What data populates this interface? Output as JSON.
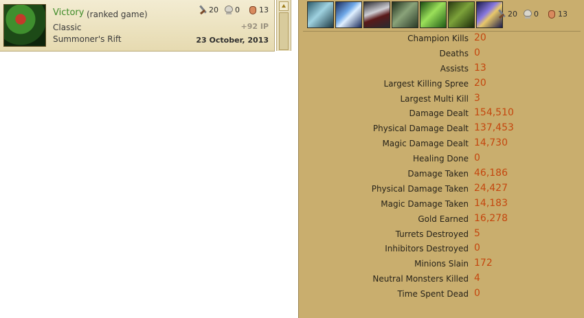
{
  "game": {
    "result": "Victory",
    "mode": "(ranked game)",
    "queue": "Classic",
    "map": "Summoner's Rift",
    "ip": "+92 IP",
    "date": "23 October, 2013",
    "champion_icon": "champion-portrait"
  },
  "kda": {
    "kills": "20",
    "deaths": "0",
    "assists": "13"
  },
  "icons": {
    "kills": "sword-icon",
    "deaths": "skull-icon",
    "assists": "hand-icon"
  },
  "items": [
    "item-1",
    "item-2",
    "item-3",
    "item-4",
    "item-5",
    "item-6",
    "item-7"
  ],
  "stats": [
    {
      "label": "Champion Kills",
      "value": "20"
    },
    {
      "label": "Deaths",
      "value": "0"
    },
    {
      "label": "Assists",
      "value": "13"
    },
    {
      "label": "Largest Killing Spree",
      "value": "20"
    },
    {
      "label": "Largest Multi Kill",
      "value": "3"
    },
    {
      "label": "Damage Dealt",
      "value": "154,510"
    },
    {
      "label": "Physical Damage Dealt",
      "value": "137,453"
    },
    {
      "label": "Magic Damage Dealt",
      "value": "14,730"
    },
    {
      "label": "Healing Done",
      "value": "0"
    },
    {
      "label": "Damage Taken",
      "value": "46,186"
    },
    {
      "label": "Physical Damage Taken",
      "value": "24,427"
    },
    {
      "label": "Magic Damage Taken",
      "value": "14,183"
    },
    {
      "label": "Gold Earned",
      "value": "16,278"
    },
    {
      "label": "Turrets Destroyed",
      "value": "5"
    },
    {
      "label": "Inhibitors Destroyed",
      "value": "0"
    },
    {
      "label": "Minions Slain",
      "value": "172"
    },
    {
      "label": "Neutral Monsters Killed",
      "value": "4"
    },
    {
      "label": "Time Spent Dead",
      "value": "0"
    }
  ],
  "colors": {
    "victory": "#3c8a26",
    "stat_value": "#c4460e",
    "panel_bg": "#c9ae6e"
  }
}
